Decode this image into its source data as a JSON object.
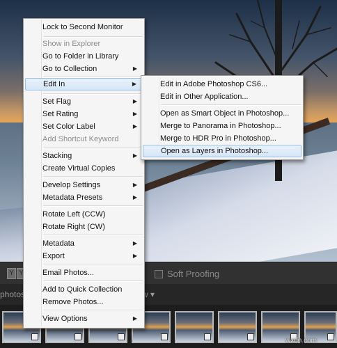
{
  "context_menu": {
    "items": [
      {
        "label": "Lock to Second Monitor",
        "disabled": false,
        "submenu": false
      },
      {
        "label": "Show in Explorer",
        "disabled": true,
        "submenu": false
      },
      {
        "label": "Go to Folder in Library",
        "disabled": false,
        "submenu": false
      },
      {
        "label": "Go to Collection",
        "disabled": false,
        "submenu": true
      },
      {
        "label": "Edit In",
        "disabled": false,
        "submenu": true,
        "highlighted": true
      },
      {
        "label": "Set Flag",
        "disabled": false,
        "submenu": true
      },
      {
        "label": "Set Rating",
        "disabled": false,
        "submenu": true
      },
      {
        "label": "Set Color Label",
        "disabled": false,
        "submenu": true
      },
      {
        "label": "Add Shortcut Keyword",
        "disabled": true,
        "submenu": false
      },
      {
        "label": "Stacking",
        "disabled": false,
        "submenu": true
      },
      {
        "label": "Create Virtual Copies",
        "disabled": false,
        "submenu": false
      },
      {
        "label": "Develop Settings",
        "disabled": false,
        "submenu": true
      },
      {
        "label": "Metadata Presets",
        "disabled": false,
        "submenu": true
      },
      {
        "label": "Rotate Left (CCW)",
        "disabled": false,
        "submenu": false
      },
      {
        "label": "Rotate Right (CW)",
        "disabled": false,
        "submenu": false
      },
      {
        "label": "Metadata",
        "disabled": false,
        "submenu": true
      },
      {
        "label": "Export",
        "disabled": false,
        "submenu": true
      },
      {
        "label": "Email Photos...",
        "disabled": false,
        "submenu": false
      },
      {
        "label": "Add to Quick Collection",
        "disabled": false,
        "submenu": false
      },
      {
        "label": "Remove Photos...",
        "disabled": false,
        "submenu": false
      },
      {
        "label": "View Options",
        "disabled": false,
        "submenu": true
      }
    ]
  },
  "edit_in_submenu": {
    "items": [
      {
        "label": "Edit in Adobe Photoshop CS6..."
      },
      {
        "label": "Edit in Other Application..."
      },
      {
        "label": "Open as Smart Object in Photoshop..."
      },
      {
        "label": "Merge to Panorama in Photoshop..."
      },
      {
        "label": "Merge to HDR Pro in Photoshop..."
      },
      {
        "label": "Open as Layers in Photoshop...",
        "highlighted": true
      }
    ]
  },
  "toolbar": {
    "soft_proofing_label": "Soft Proofing",
    "soft_proofing_checked": false,
    "buttons": [
      "Y",
      "Y"
    ]
  },
  "filmstrip": {
    "source_label": "photos",
    "sort_label": "w ▾",
    "thumbnail_count": 8
  },
  "watermark": "wxdn.com",
  "colors": {
    "menu_highlight": "#d6e6f8",
    "menu_highlight_border": "#9ac0e6",
    "disabled_text": "#8d8d8d"
  },
  "icons": {
    "submenu": "triangle-right-icon",
    "checkbox": "checkbox-icon",
    "thumbnail_badge": "edit-badge-icon"
  }
}
